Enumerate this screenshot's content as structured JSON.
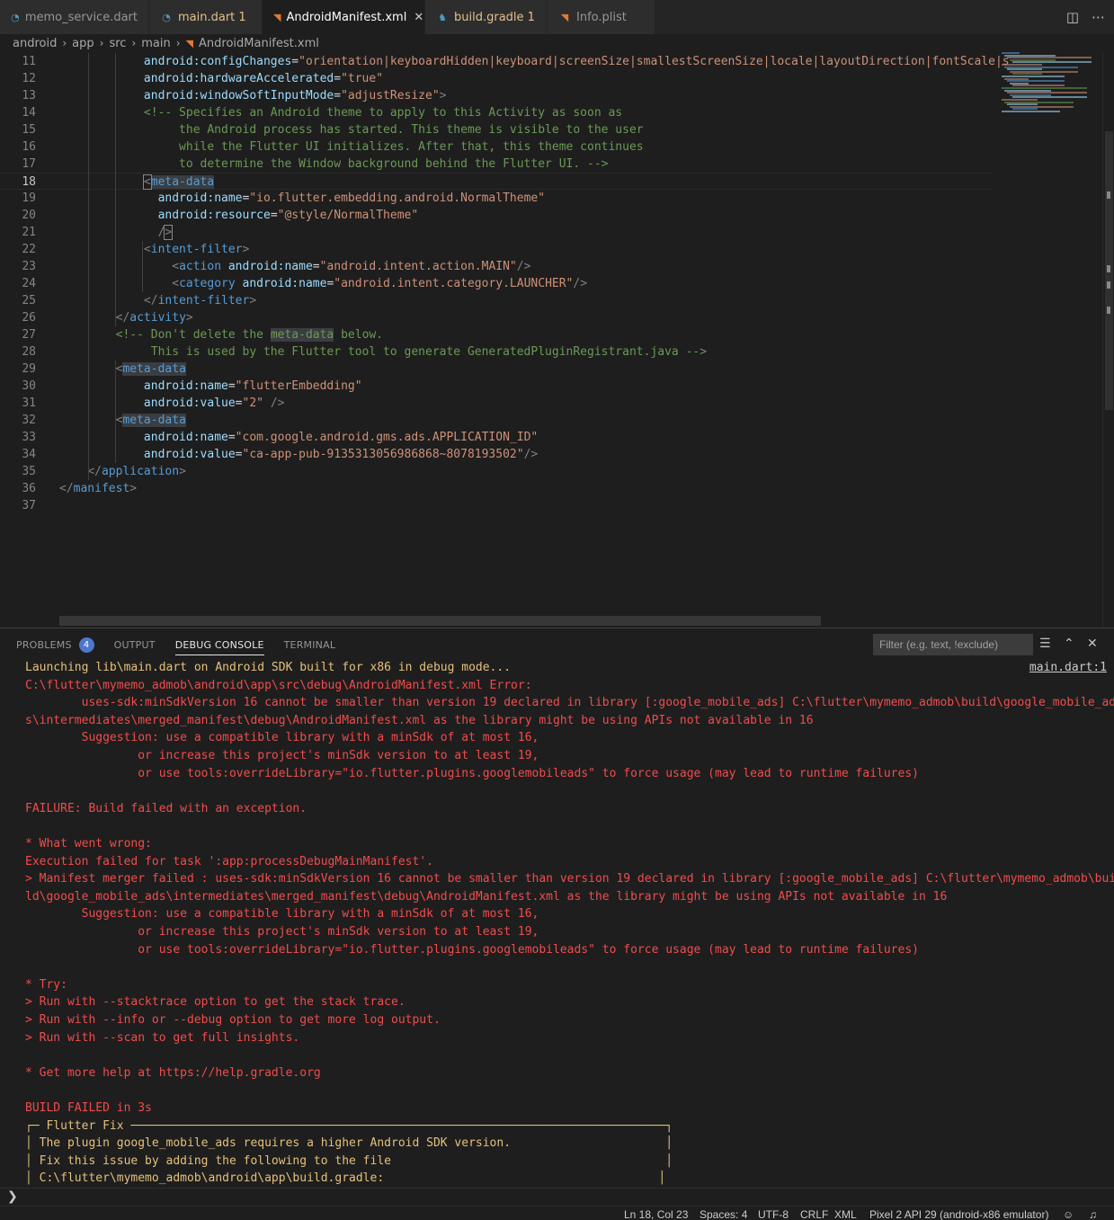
{
  "tabs": [
    {
      "label": "memo_service.dart",
      "icon": "dart-icon",
      "badge": ""
    },
    {
      "label": "main.dart 1",
      "icon": "dart-icon",
      "badge": "1"
    },
    {
      "label": "AndroidManifest.xml",
      "icon": "rss-icon",
      "badge": ""
    },
    {
      "label": "build.gradle 1",
      "icon": "gradle-icon",
      "badge": "1"
    },
    {
      "label": "Info.plist",
      "icon": "rss-icon",
      "badge": ""
    }
  ],
  "breadcrumb": [
    "android",
    "app",
    "src",
    "main",
    "AndroidManifest.xml"
  ],
  "editor": {
    "current_line": 18,
    "lines": [
      {
        "n": "11",
        "html": "            <span class='t-attr'>android:configChanges</span>=<span class='t-str'>\"orientation|keyboardHidden|keyboard|screenSize|smallestScreenSize|locale|layoutDirection|fontScale|s</span>"
      },
      {
        "n": "12",
        "html": "            <span class='t-attr'>android:hardwareAccelerated</span>=<span class='t-str'>\"true\"</span>"
      },
      {
        "n": "13",
        "html": "            <span class='t-attr'>android:windowSoftInputMode</span>=<span class='t-str'>\"adjustResize\"</span><span class='t-punc'>&gt;</span>"
      },
      {
        "n": "14",
        "html": "            <span class='t-com'>&lt;!-- Specifies an Android theme to apply to this Activity as soon as</span>"
      },
      {
        "n": "15",
        "html": "<span class='t-com'>                 the Android process has started. This theme is visible to the user</span>"
      },
      {
        "n": "16",
        "html": "<span class='t-com'>                 while the Flutter UI initializes. After that, this theme continues</span>"
      },
      {
        "n": "17",
        "html": "<span class='t-com'>                 to determine the Window background behind the Flutter UI. --&gt;</span>"
      },
      {
        "n": "18",
        "html": "            <span class='t-punc bracket-box'>&lt;</span><span class='t-tag hl'>meta-data</span>"
      },
      {
        "n": "19",
        "html": "              <span class='t-attr'>android:name</span>=<span class='t-str'>\"io.flutter.embedding.android.NormalTheme\"</span>"
      },
      {
        "n": "20",
        "html": "              <span class='t-attr'>android:resource</span>=<span class='t-str'>\"@style/NormalTheme\"</span>"
      },
      {
        "n": "21",
        "html": "              <span class='t-punc'>/</span><span class='t-punc bracket-box'>&gt;</span>"
      },
      {
        "n": "22",
        "html": "            <span class='t-punc'>&lt;</span><span class='t-tag'>intent-filter</span><span class='t-punc'>&gt;</span>"
      },
      {
        "n": "23",
        "html": "                <span class='t-punc'>&lt;</span><span class='t-tag'>action</span> <span class='t-attr'>android:name</span>=<span class='t-str'>\"android.intent.action.MAIN\"</span><span class='t-punc'>/&gt;</span>"
      },
      {
        "n": "24",
        "html": "                <span class='t-punc'>&lt;</span><span class='t-tag'>category</span> <span class='t-attr'>android:name</span>=<span class='t-str'>\"android.intent.category.LAUNCHER\"</span><span class='t-punc'>/&gt;</span>"
      },
      {
        "n": "25",
        "html": "            <span class='t-punc'>&lt;/</span><span class='t-tag'>intent-filter</span><span class='t-punc'>&gt;</span>"
      },
      {
        "n": "26",
        "html": "        <span class='t-punc'>&lt;/</span><span class='t-tag'>activity</span><span class='t-punc'>&gt;</span>"
      },
      {
        "n": "27",
        "html": "        <span class='t-com'>&lt;!-- Don't delete the </span><span class='t-com hl'>meta-data</span><span class='t-com'> below.</span>"
      },
      {
        "n": "28",
        "html": "<span class='t-com'>             This is used by the Flutter tool to generate GeneratedPluginRegistrant.java --&gt;</span>"
      },
      {
        "n": "29",
        "html": "        <span class='t-punc'>&lt;</span><span class='t-tag hl'>meta-data</span>"
      },
      {
        "n": "30",
        "html": "            <span class='t-attr'>android:name</span>=<span class='t-str'>\"flutterEmbedding\"</span>"
      },
      {
        "n": "31",
        "html": "            <span class='t-attr'>android:value</span>=<span class='t-str'>\"2\"</span> <span class='t-punc'>/&gt;</span>"
      },
      {
        "n": "32",
        "html": "        <span class='t-punc'>&lt;</span><span class='t-tag hl'>meta-data</span>"
      },
      {
        "n": "33",
        "html": "            <span class='t-attr'>android:name</span>=<span class='t-str'>\"com.google.android.gms.ads.APPLICATION_ID\"</span>"
      },
      {
        "n": "34",
        "html": "            <span class='t-attr'>android:value</span>=<span class='t-str'>\"ca-app-pub-9135313056986868~8078193502\"</span><span class='t-punc'>/&gt;</span>"
      },
      {
        "n": "35",
        "html": "    <span class='t-punc'>&lt;/</span><span class='t-tag'>application</span><span class='t-punc'>&gt;</span>"
      },
      {
        "n": "36",
        "html": "<span class='t-punc'>&lt;/</span><span class='t-tag'>manifest</span><span class='t-punc'>&gt;</span>"
      },
      {
        "n": "37",
        "html": ""
      }
    ]
  },
  "panel": {
    "tabs": [
      {
        "label": "PROBLEMS",
        "badge": "4"
      },
      {
        "label": "OUTPUT",
        "badge": ""
      },
      {
        "label": "DEBUG CONSOLE",
        "badge": ""
      },
      {
        "label": "TERMINAL",
        "badge": ""
      }
    ],
    "active_tab": "DEBUG CONSOLE",
    "filter_placeholder": "Filter (e.g. text, !exclude)",
    "console_link": "main.dart:1",
    "console_lines": [
      {
        "text": "Launching lib\\main.dart on Android SDK built for x86 in debug mode...",
        "style": "yellow"
      },
      {
        "text": "C:\\flutter\\mymemo_admob\\android\\app\\src\\debug\\AndroidManifest.xml Error:",
        "style": "red"
      },
      {
        "text": "        uses-sdk:minSdkVersion 16 cannot be smaller than version 19 declared in library [:google_mobile_ads] C:\\flutter\\mymemo_admob\\build\\google_mobile_ad",
        "style": "red"
      },
      {
        "text": "s\\intermediates\\merged_manifest\\debug\\AndroidManifest.xml as the library might be using APIs not available in 16",
        "style": "red"
      },
      {
        "text": "        Suggestion: use a compatible library with a minSdk of at most 16,",
        "style": "red"
      },
      {
        "text": "                or increase this project's minSdk version to at least 19,",
        "style": "red"
      },
      {
        "text": "                or use tools:overrideLibrary=\"io.flutter.plugins.googlemobileads\" to force usage (may lead to runtime failures)",
        "style": "red"
      },
      {
        "text": "",
        "style": "red"
      },
      {
        "text": "FAILURE: Build failed with an exception.",
        "style": "red"
      },
      {
        "text": "",
        "style": "red"
      },
      {
        "text": "* What went wrong:",
        "style": "red"
      },
      {
        "text": "Execution failed for task ':app:processDebugMainManifest'.",
        "style": "red"
      },
      {
        "text": "> Manifest merger failed : uses-sdk:minSdkVersion 16 cannot be smaller than version 19 declared in library [:google_mobile_ads] C:\\flutter\\mymemo_admob\\bui",
        "style": "red"
      },
      {
        "text": "ld\\google_mobile_ads\\intermediates\\merged_manifest\\debug\\AndroidManifest.xml as the library might be using APIs not available in 16",
        "style": "red"
      },
      {
        "text": "        Suggestion: use a compatible library with a minSdk of at most 16,",
        "style": "red"
      },
      {
        "text": "                or increase this project's minSdk version to at least 19,",
        "style": "red"
      },
      {
        "text": "                or use tools:overrideLibrary=\"io.flutter.plugins.googlemobileads\" to force usage (may lead to runtime failures)",
        "style": "red"
      },
      {
        "text": "",
        "style": "red"
      },
      {
        "text": "* Try:",
        "style": "red"
      },
      {
        "text": "> Run with --stacktrace option to get the stack trace.",
        "style": "red"
      },
      {
        "text": "> Run with --info or --debug option to get more log output.",
        "style": "red"
      },
      {
        "text": "> Run with --scan to get full insights.",
        "style": "red"
      },
      {
        "text": "",
        "style": "red"
      },
      {
        "text": "* Get more help at https://help.gradle.org",
        "style": "red"
      },
      {
        "text": "",
        "style": "red"
      },
      {
        "text": "BUILD FAILED in 3s",
        "style": "red"
      },
      {
        "text": "┌─ Flutter Fix ────────────────────────────────────────────────────────────────────────────┐",
        "style": "box"
      },
      {
        "text": "│ The plugin google_mobile_ads requires a higher Android SDK version.                      │",
        "style": "box"
      },
      {
        "text": "│ Fix this issue by adding the following to the file                                       │",
        "style": "box"
      },
      {
        "text": "│ C:\\flutter\\mymemo_admob\\android\\app\\build.gradle:                                       │",
        "style": "box"
      }
    ]
  },
  "statusbar": {
    "position": "Ln 18, Col 23",
    "spaces": "Spaces: 4",
    "encoding": "UTF-8",
    "eol": "CRLF",
    "language": "XML",
    "device": "Pixel 2 API 29 (android-x86 emulator)"
  },
  "colors": {
    "error": "#f14c4c",
    "warning": "#e5c07b",
    "accent": "#4d78cc"
  }
}
